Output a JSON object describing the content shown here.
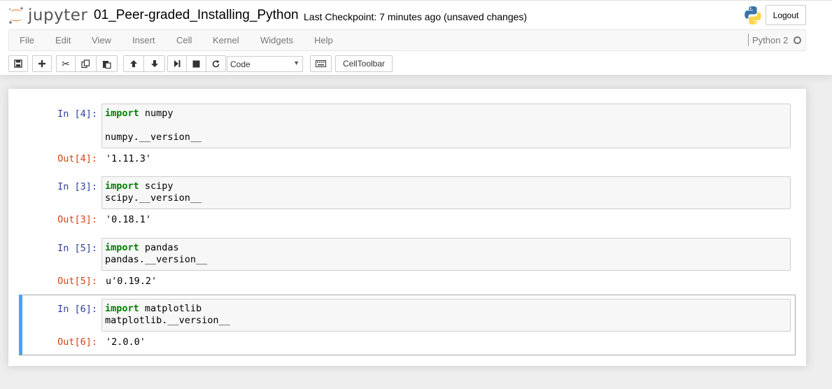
{
  "header": {
    "logo_text": "jupyter",
    "notebook_title": "01_Peer-graded_Installing_Python",
    "checkpoint_text": "Last Checkpoint: 7 minutes ago (unsaved changes)",
    "logout_label": "Logout"
  },
  "menubar": {
    "items": [
      "File",
      "Edit",
      "View",
      "Insert",
      "Cell",
      "Kernel",
      "Widgets",
      "Help"
    ],
    "kernel_name": "Python 2"
  },
  "toolbar": {
    "cell_type": "Code",
    "celltoolbar_label": "CellToolbar",
    "icons": [
      "save-icon",
      "plus-icon",
      "cut-icon",
      "copy-icon",
      "paste-icon",
      "arrow-up-icon",
      "arrow-down-icon",
      "run-icon",
      "stop-icon",
      "restart-icon",
      "keyboard-icon"
    ]
  },
  "cells": [
    {
      "in_prompt": "In [4]:",
      "out_prompt": "Out[4]:",
      "keyword": "import",
      "module": " numpy",
      "line2": "",
      "line3": "numpy.__version__",
      "output": "'1.11.3'"
    },
    {
      "in_prompt": "In [3]:",
      "out_prompt": "Out[3]:",
      "keyword": "import",
      "module": " scipy",
      "line2": "scipy.__version__",
      "output": "'0.18.1'"
    },
    {
      "in_prompt": "In [5]:",
      "out_prompt": "Out[5]:",
      "keyword": "import",
      "module": " pandas",
      "line2": "pandas.__version__",
      "output": "u'0.19.2'"
    },
    {
      "in_prompt": "In [6]:",
      "out_prompt": "Out[6]:",
      "keyword": "import",
      "module": " matplotlib",
      "line2": "matplotlib.__version__",
      "output": "'2.0.0'"
    }
  ],
  "colors": {
    "selected_cell_accent": "#42a5f5",
    "in_prompt": "#303f9f",
    "out_prompt": "#d84315",
    "keyword": "#008000"
  }
}
